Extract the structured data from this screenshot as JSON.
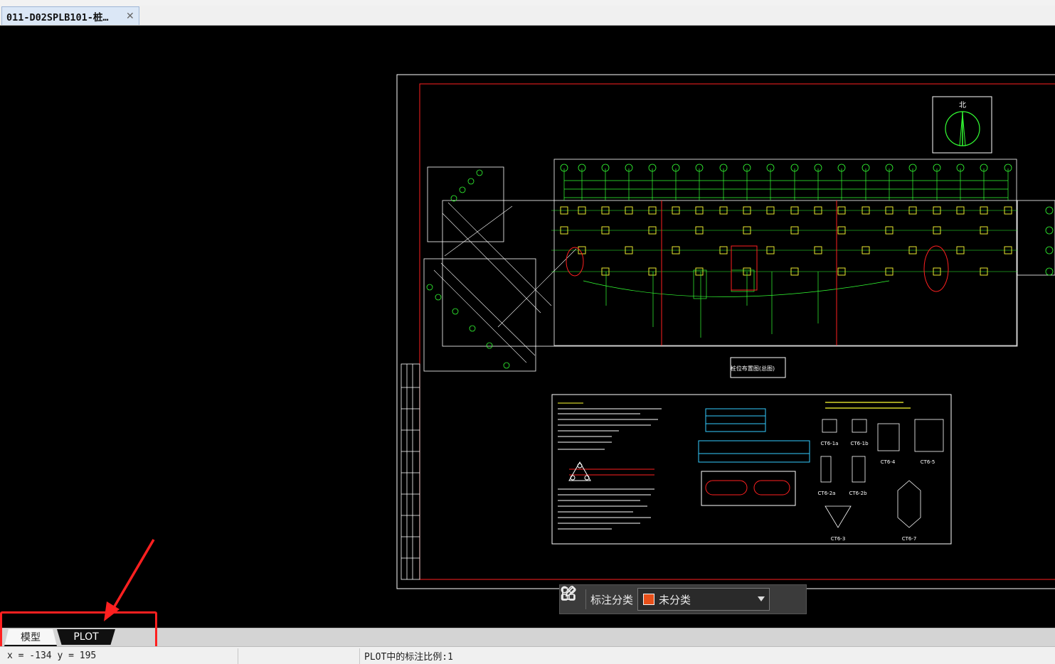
{
  "document_tab": {
    "title": "011-D02SPLB101-桩…"
  },
  "drawing": {
    "north_label": "北",
    "title_block_label": "桩位布置图(总图)",
    "pile_cap_labels": [
      "CT6-1a",
      "CT6-1b",
      "CT6-4",
      "CT6-5",
      "CT6-2a",
      "CT6-2b",
      "CT6-3",
      "CT6-7"
    ]
  },
  "annotation_toolbar": {
    "label": "标注分类",
    "category_value": "未分类",
    "category_color": "#e8501a"
  },
  "layout_tabs": [
    {
      "label": "模型"
    },
    {
      "label": "PLOT",
      "active": true
    }
  ],
  "status": {
    "coordinates": "x = -134 y = 195",
    "plot_scale": "PLOT中的标注比例:1"
  },
  "colors": {
    "drawing_bg": "#000000",
    "frame": "#ffffff",
    "border_red": "#ff2020",
    "grid_green": "#33ff33",
    "accent_yellow": "#ffff33"
  }
}
